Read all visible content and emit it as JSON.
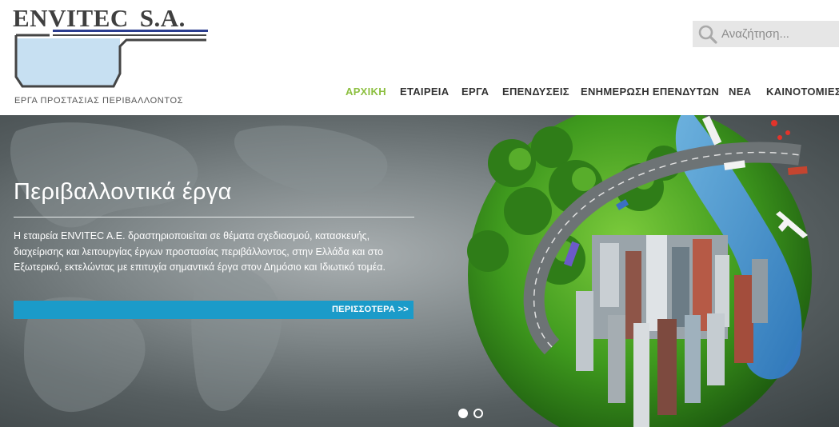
{
  "brand": {
    "name": "ENVITEC",
    "suffix": "S.A.",
    "tagline": "ΕΡΓΑ ΠΡΟΣΤΑΣΙΑΣ ΠΕΡΙΒΑΛΛΟΝΤΟΣ",
    "colors": {
      "accent_blue": "#2b3d8f",
      "water": "#c7e0f2",
      "outline": "#444444"
    }
  },
  "search": {
    "placeholder": "Αναζήτηση...",
    "icon": "search-icon"
  },
  "nav": {
    "active_color": "#8cbf3f",
    "items": [
      {
        "label": "ΑΡΧΙΚΗ",
        "active": true
      },
      {
        "label": "ΕΤΑΙΡΕΙΑ",
        "active": false
      },
      {
        "label": "ΕΡΓΑ",
        "active": false
      },
      {
        "label": "ΕΠΕΝΔΥΣΕΙΣ",
        "active": false
      },
      {
        "label": "ΕΝΗΜΕΡΩΣΗ ΕΠΕΝΔΥΤΩΝ",
        "active": false
      },
      {
        "label": "ΝΕΑ",
        "active": false
      },
      {
        "label": "ΚΑΙΝΟΤΟΜΙΕΣ",
        "active": false
      }
    ]
  },
  "hero": {
    "title": "Περιβαλλοντικά έργα",
    "text": "Η εταιρεία ENVITEC A.E. δραστηριοποιείται σε θέματα σχεδιασμού, κατασκευής, διαχείρισης και λειτουργίας έργων προστασίας περιβάλλοντος, στην Ελλάδα και στο Εξωτερικό, εκτελώντας με επιτυχία σημαντικά έργα στον Δημόσιο και Ιδιωτικό τομέα.",
    "button_label": "ΠΕΡΙΣΣΟΤΕΡΑ >>",
    "button_color": "#1b9bc9",
    "slides": [
      {
        "active": true
      },
      {
        "active": false
      }
    ]
  }
}
